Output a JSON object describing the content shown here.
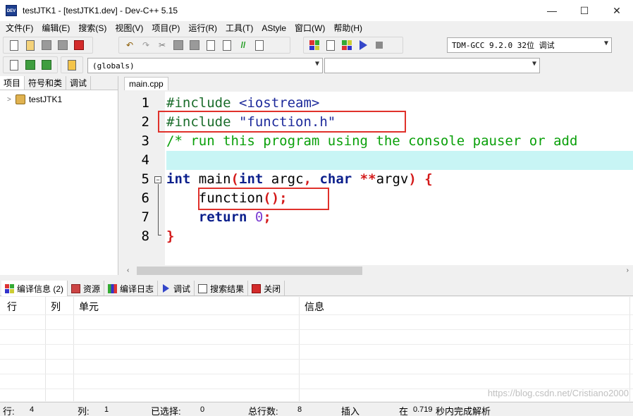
{
  "window": {
    "title": "testJTK1 - [testJTK1.dev] - Dev-C++ 5.15",
    "app_icon_text": "DEV",
    "minimize": "—",
    "maximize": "☐",
    "close": "✕"
  },
  "menu": [
    "文件(F)",
    "编辑(E)",
    "搜索(S)",
    "视图(V)",
    "项目(P)",
    "运行(R)",
    "工具(T)",
    "AStyle",
    "窗口(W)",
    "帮助(H)"
  ],
  "toolbar": {
    "compiler_select": "TDM-GCC 9.2.0 32位 调试",
    "scope_select": "(globals)",
    "function_select": ""
  },
  "left_panel": {
    "tabs": [
      "项目",
      "符号和类",
      "调试"
    ],
    "project_item": "testJTK1"
  },
  "editor": {
    "tab": "main.cpp",
    "line_numbers": [
      "1",
      "2",
      "3",
      "4",
      "5",
      "6",
      "7",
      "8"
    ],
    "current_line": 4
  },
  "bottom_panel": {
    "tabs": [
      "编译信息 (2)",
      "资源",
      "编译日志",
      "调试",
      "搜索结果",
      "关闭"
    ],
    "columns": [
      "行",
      "列",
      "单元",
      "信息"
    ],
    "watermark": "https://blog.csdn.net/Cristiano2000"
  },
  "status": {
    "line_label": "行:",
    "line_value": "4",
    "col_label": "列:",
    "col_value": "1",
    "selected_label": "已选择:",
    "selected_value": "0",
    "total_label": "总行数:",
    "total_value": "8",
    "mode": "插入",
    "parse_prefix": "在",
    "parse_time": "0.719",
    "parse_suffix": "秒内完成解析"
  },
  "colors": {
    "highlight_line": "#c8f5f5",
    "annotation_box": "#e0312b",
    "keyword": "#0b1f8c",
    "comment": "#0aa00a"
  }
}
